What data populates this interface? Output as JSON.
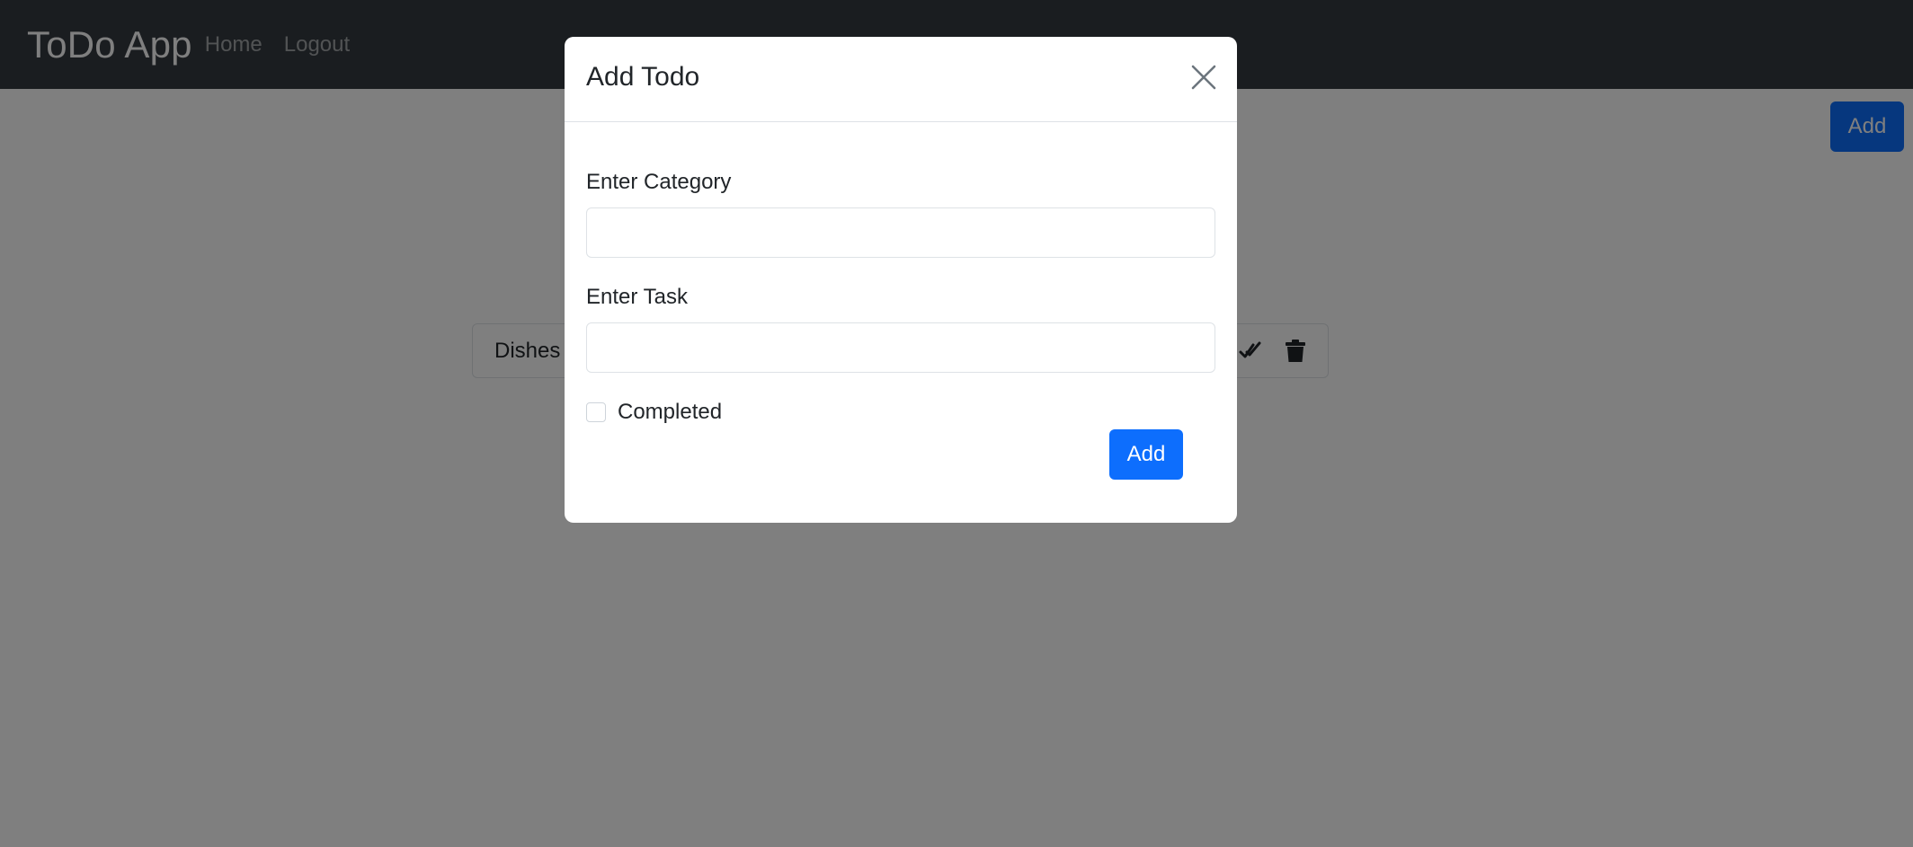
{
  "navbar": {
    "brand": "ToDo App",
    "links": [
      "Home",
      "Logout"
    ]
  },
  "main": {
    "add_label": "Add",
    "todos": [
      {
        "category": "Dishes"
      }
    ],
    "icons": [
      "check-icon",
      "trash-icon"
    ]
  },
  "modal": {
    "title": "Add Todo",
    "close_icon": "close-icon",
    "category_label": "Enter Category",
    "category_value": "",
    "task_label": "Enter Task",
    "task_value": "",
    "completed_label": "Completed",
    "completed_checked": false,
    "submit_label": "Add"
  },
  "colors": {
    "navbar": "#343a40",
    "primary": "#0d6efd",
    "backdrop": "rgba(0,0,0,0.5)"
  }
}
